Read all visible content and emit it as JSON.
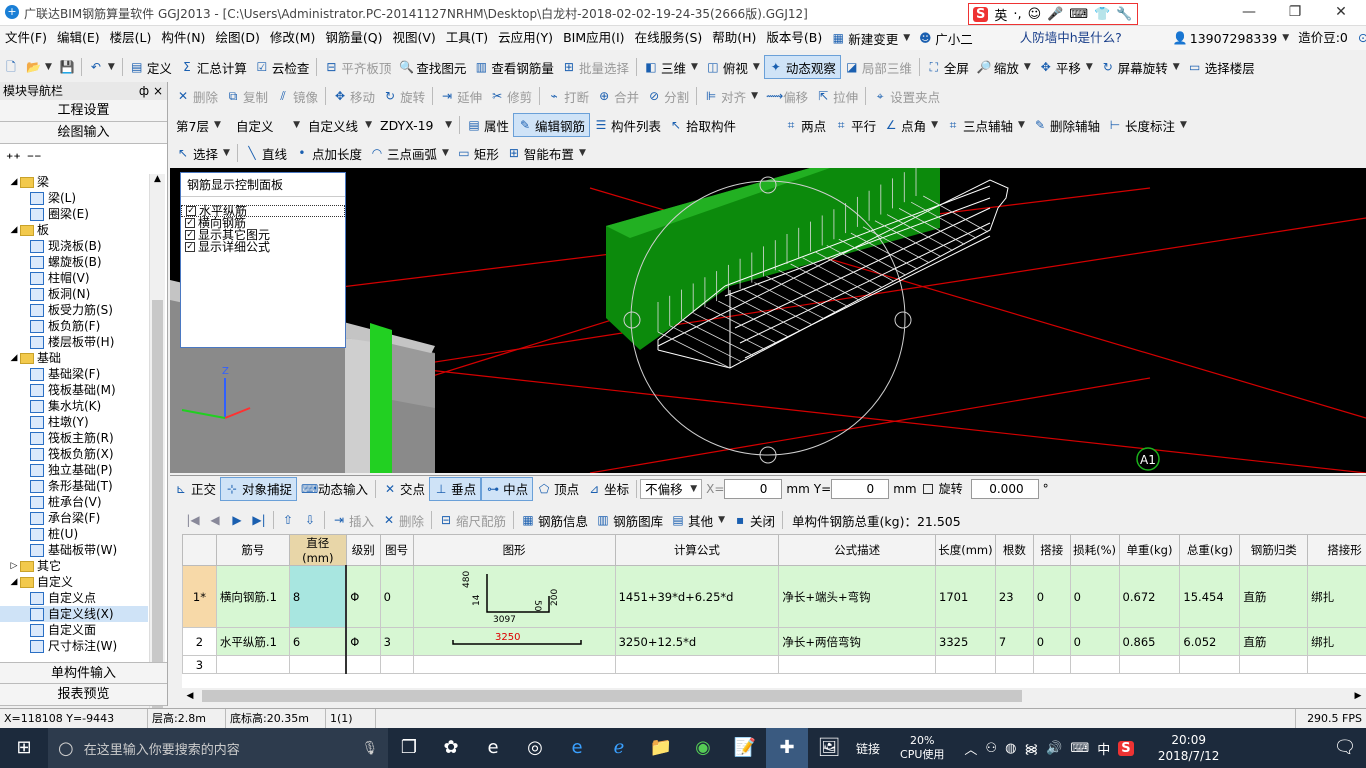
{
  "titlebar": {
    "title": "广联达BIM钢筋算量软件 GGJ2013 - [C:\\Users\\Administrator.PC-20141127NRHM\\Desktop\\白龙村-2018-02-02-19-24-35(2666版).GGJ12]",
    "ime_label": "英",
    "minimize": "—",
    "maximize": "❐",
    "close": "✕"
  },
  "menubar": {
    "items": [
      "文件(F)",
      "编辑(E)",
      "楼层(L)",
      "构件(N)",
      "绘图(D)",
      "修改(M)",
      "钢筋量(Q)",
      "视图(V)",
      "工具(T)",
      "云应用(Y)",
      "BIM应用(I)",
      "在线服务(S)",
      "帮助(H)",
      "版本号(B)"
    ],
    "new_change": "新建变更",
    "assistant": "广小二",
    "question": "人防墙中h是什么?",
    "phone": "13907298339",
    "beans": "造价豆:0"
  },
  "toolbar1": {
    "items": [
      "定义",
      "汇总计算",
      "云检查",
      "平齐板顶",
      "查找图元",
      "查看钢筋量",
      "批量选择"
    ],
    "view": [
      "三维",
      "俯视",
      "动态观察",
      "局部三维",
      "全屏",
      "缩放",
      "平移",
      "屏幕旋转",
      "选择楼层"
    ]
  },
  "toolbar2": {
    "items": [
      "删除",
      "复制",
      "镜像",
      "移动",
      "旋转",
      "延伸",
      "修剪",
      "打断",
      "合并",
      "分割",
      "对齐",
      "偏移",
      "拉伸",
      "设置夹点"
    ]
  },
  "toolbar3": {
    "floor": "第7层",
    "category": "自定义",
    "type": "自定义线",
    "name": "ZDYX-19",
    "items": [
      "属性",
      "编辑钢筋",
      "构件列表",
      "拾取构件"
    ],
    "axis": [
      "两点",
      "平行",
      "点角",
      "三点辅轴",
      "删除辅轴",
      "长度标注"
    ]
  },
  "toolbar4": {
    "items": [
      "选择",
      "直线",
      "点加长度",
      "三点画弧",
      "矩形",
      "智能布置"
    ]
  },
  "nav": {
    "title": "模块导航栏",
    "pin": "ф",
    "close": "×",
    "btn_project": "工程设置",
    "btn_draw": "绘图输入",
    "btn_single": "单构件输入",
    "btn_report": "报表预览",
    "tree": [
      {
        "t": "folder",
        "label": "梁"
      },
      {
        "t": "leaf",
        "label": "梁(L)"
      },
      {
        "t": "leaf",
        "label": "圈梁(E)"
      },
      {
        "t": "folder",
        "label": "板"
      },
      {
        "t": "leaf",
        "label": "现浇板(B)"
      },
      {
        "t": "leaf",
        "label": "螺旋板(B)"
      },
      {
        "t": "leaf",
        "label": "柱帽(V)"
      },
      {
        "t": "leaf",
        "label": "板洞(N)"
      },
      {
        "t": "leaf",
        "label": "板受力筋(S)"
      },
      {
        "t": "leaf",
        "label": "板负筋(F)"
      },
      {
        "t": "leaf",
        "label": "楼层板带(H)"
      },
      {
        "t": "folder",
        "label": "基础"
      },
      {
        "t": "leaf",
        "label": "基础梁(F)"
      },
      {
        "t": "leaf",
        "label": "筏板基础(M)"
      },
      {
        "t": "leaf",
        "label": "集水坑(K)"
      },
      {
        "t": "leaf",
        "label": "柱墩(Y)"
      },
      {
        "t": "leaf",
        "label": "筏板主筋(R)"
      },
      {
        "t": "leaf",
        "label": "筏板负筋(X)"
      },
      {
        "t": "leaf",
        "label": "独立基础(P)"
      },
      {
        "t": "leaf",
        "label": "条形基础(T)"
      },
      {
        "t": "leaf",
        "label": "桩承台(V)"
      },
      {
        "t": "leaf",
        "label": "承台梁(F)"
      },
      {
        "t": "leaf",
        "label": "桩(U)"
      },
      {
        "t": "leaf",
        "label": "基础板带(W)"
      },
      {
        "t": "folder-closed",
        "label": "其它"
      },
      {
        "t": "folder",
        "label": "自定义"
      },
      {
        "t": "leaf",
        "label": "自定义点"
      },
      {
        "t": "leaf-sel",
        "label": "自定义线(X)"
      },
      {
        "t": "leaf",
        "label": "自定义面"
      },
      {
        "t": "leaf",
        "label": "尺寸标注(W)"
      }
    ]
  },
  "panel": {
    "title": "钢筋显示控制面板",
    "checks": [
      "水平纵筋",
      "横向钢筋",
      "显示其它图元",
      "显示详细公式"
    ]
  },
  "canvas": {
    "axis_marker": "A1"
  },
  "snapbar": {
    "items": [
      "正交",
      "对象捕捉",
      "动态输入",
      "交点",
      "垂点",
      "中点",
      "顶点",
      "坐标"
    ],
    "offset": "不偏移",
    "x_label": "X=",
    "x_value": "0",
    "unit_mm": "mm",
    "y_label": "Y=",
    "y_value": "0",
    "rotate_label": "旋转",
    "rotate_value": "0.000",
    "degree": "°"
  },
  "gridbar": {
    "items": [
      "插入",
      "删除",
      "缩尺配筋",
      "钢筋信息",
      "钢筋图库",
      "其他",
      "关闭"
    ],
    "total": "单构件钢筋总重(kg)：21.505"
  },
  "grid": {
    "headers": [
      "",
      "筋号",
      "直径(mm)",
      "级别",
      "图号",
      "图形",
      "计算公式",
      "公式描述",
      "长度(mm)",
      "根数",
      "搭接",
      "损耗(%)",
      "单重(kg)",
      "总重(kg)",
      "钢筋归类",
      "搭接形"
    ],
    "rows": [
      {
        "idx": "1*",
        "name": "横向钢筋.1",
        "dia": "8",
        "grade": "Φ",
        "fig": "0",
        "formula": "1451+39*d+6.25*d",
        "desc": "净长+端头+弯钩",
        "len": "1701",
        "count": "23",
        "lap": "0",
        "loss": "0",
        "unit": "0.672",
        "total": "15.454",
        "class": "直筋",
        "laptype": "绑扎"
      },
      {
        "idx": "2",
        "name": "水平纵筋.1",
        "dia": "6",
        "grade": "Φ",
        "fig": "3",
        "formula": "3250+12.5*d",
        "desc": "净长+两倍弯钩",
        "len": "3325",
        "count": "7",
        "lap": "0",
        "loss": "0",
        "unit": "0.865",
        "total": "6.052",
        "class": "直筋",
        "laptype": "绑扎"
      },
      {
        "idx": "3",
        "name": "",
        "dia": "",
        "grade": "",
        "fig": "",
        "formula": "",
        "desc": "",
        "len": "",
        "count": "",
        "lap": "",
        "loss": "",
        "unit": "",
        "total": "",
        "class": "",
        "laptype": ""
      }
    ],
    "shape1": {
      "a": "480",
      "b": "50",
      "c": "200",
      "d": "14",
      "e": "3097"
    },
    "shape2": {
      "a": "3250"
    }
  },
  "status": {
    "coords": "X=118108  Y=-9443",
    "floor_height": "层高:2.8m",
    "bottom_height": "底标高:20.35m",
    "count": "1(1)",
    "fps": "290.5 FPS"
  },
  "taskbar": {
    "search": "在这里输入你要搜索的内容",
    "link": "链接",
    "cpu_pct": "20%",
    "cpu_label": "CPU使用",
    "lang": "中",
    "time": "20:09",
    "date": "2018/7/12"
  }
}
